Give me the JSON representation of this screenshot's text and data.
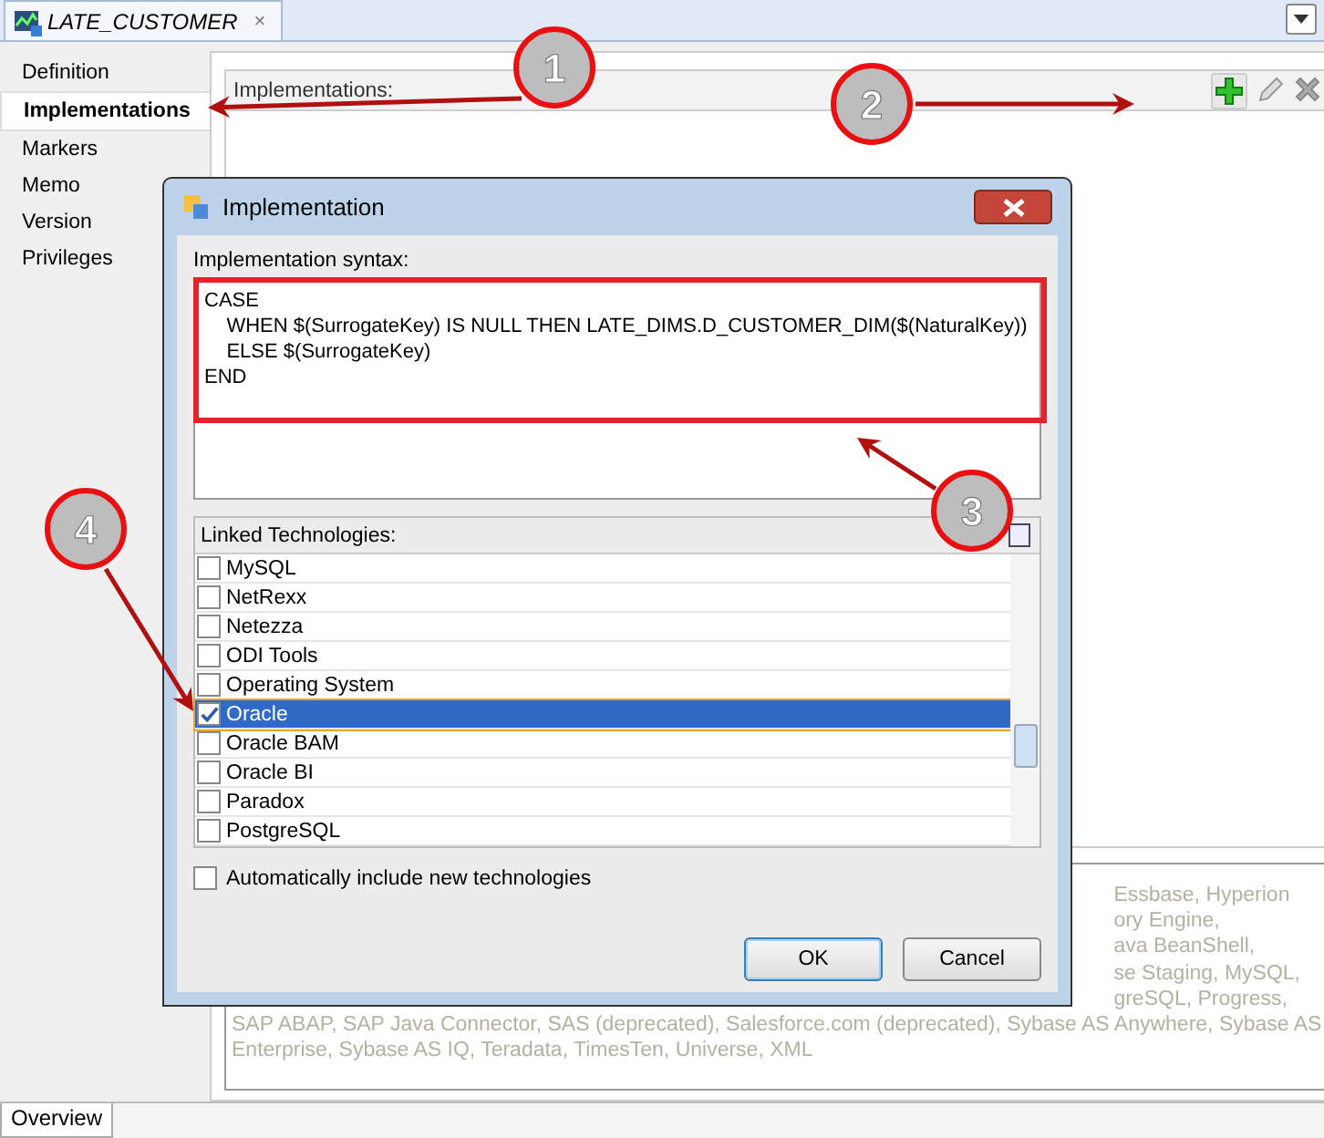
{
  "editor_tab": {
    "title": "LATE_CUSTOMER",
    "close": "×"
  },
  "nav": [
    {
      "label": "Definition",
      "selected": false
    },
    {
      "label": "Implementations",
      "selected": true
    },
    {
      "label": "Markers",
      "selected": false
    },
    {
      "label": "Memo",
      "selected": false
    },
    {
      "label": "Version",
      "selected": false
    },
    {
      "label": "Privileges",
      "selected": false
    }
  ],
  "implementations": {
    "label": "Implementations:",
    "toolbar": [
      {
        "kind": "add"
      },
      {
        "kind": "edit"
      },
      {
        "kind": "delete"
      }
    ]
  },
  "technologies_text": {
    "fragments": [
      "Essbase, Hyperion",
      "ory Engine,",
      "ava BeanShell,",
      "se Staging, MySQL,",
      "greSQL, Progress,"
    ],
    "lines": [
      "SAP ABAP, SAP Java Connector, SAS (deprecated), Salesforce.com (deprecated), Sybase AS Anywhere, Sybase AS",
      "Enterprise, Sybase AS IQ, Teradata, TimesTen, Universe, XML"
    ]
  },
  "dialog": {
    "title": "Implementation",
    "syntax_label": "Implementation syntax:",
    "syntax": [
      "CASE",
      "    WHEN $(SurrogateKey) IS NULL THEN LATE_DIMS.D_CUSTOMER_DIM($(NaturalKey))",
      "    ELSE $(SurrogateKey)",
      "END"
    ],
    "linked_label": "Linked Technologies:",
    "technologies": [
      {
        "name": "MySQL",
        "checked": false,
        "selected": false
      },
      {
        "name": "NetRexx",
        "checked": false,
        "selected": false
      },
      {
        "name": "Netezza",
        "checked": false,
        "selected": false
      },
      {
        "name": "ODI Tools",
        "checked": false,
        "selected": false
      },
      {
        "name": "Operating System",
        "checked": false,
        "selected": false
      },
      {
        "name": "Oracle",
        "checked": true,
        "selected": true
      },
      {
        "name": "Oracle BAM",
        "checked": false,
        "selected": false
      },
      {
        "name": "Oracle BI",
        "checked": false,
        "selected": false
      },
      {
        "name": "Paradox",
        "checked": false,
        "selected": false
      },
      {
        "name": "PostgreSQL",
        "checked": false,
        "selected": false
      }
    ],
    "auto_include": {
      "label": "Automatically include new technologies",
      "checked": false
    },
    "buttons": [
      {
        "label": "OK",
        "default": true
      },
      {
        "label": "Cancel",
        "default": false
      }
    ]
  },
  "bottom_tab": {
    "label": "Overview"
  },
  "callouts": [
    "1",
    "2",
    "3",
    "4"
  ]
}
